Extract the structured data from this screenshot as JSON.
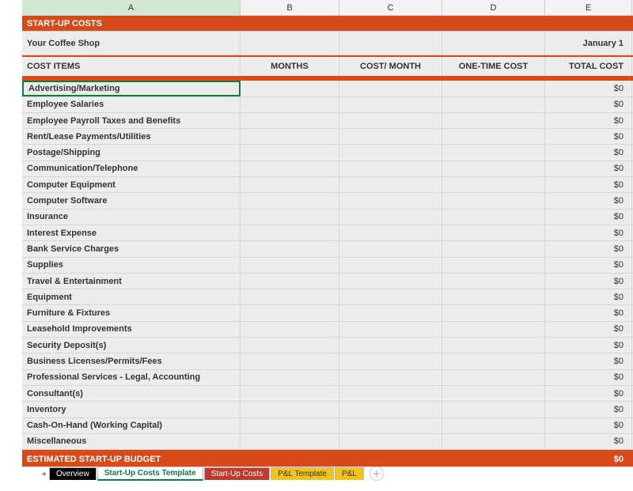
{
  "columns": {
    "a": "A",
    "b": "B",
    "c": "C",
    "d": "D",
    "e": "E"
  },
  "title": "START-UP COSTS",
  "subheader": {
    "label": "Your Coffee Shop",
    "date": "January 1"
  },
  "col_labels": {
    "a": "COST ITEMS",
    "b": "MONTHS",
    "c": "COST/ MONTH",
    "d": "ONE-TIME COST",
    "e": "TOTAL COST"
  },
  "rows": [
    {
      "label": "Advertising/Marketing",
      "total": "$0"
    },
    {
      "label": "Employee Salaries",
      "total": "$0"
    },
    {
      "label": "Employee Payroll Taxes and Benefits",
      "total": "$0"
    },
    {
      "label": "Rent/Lease Payments/Utilities",
      "total": "$0"
    },
    {
      "label": "Postage/Shipping",
      "total": "$0"
    },
    {
      "label": "Communication/Telephone",
      "total": "$0"
    },
    {
      "label": "Computer Equipment",
      "total": "$0"
    },
    {
      "label": "Computer Software",
      "total": "$0"
    },
    {
      "label": "Insurance",
      "total": "$0"
    },
    {
      "label": "Interest Expense",
      "total": "$0"
    },
    {
      "label": "Bank Service Charges",
      "total": "$0"
    },
    {
      "label": "Supplies",
      "total": "$0"
    },
    {
      "label": "Travel & Entertainment",
      "total": "$0"
    },
    {
      "label": "Equipment",
      "total": "$0"
    },
    {
      "label": "Furniture & Fixtures",
      "total": "$0"
    },
    {
      "label": "Leasehold Improvements",
      "total": "$0"
    },
    {
      "label": "Security Deposit(s)",
      "total": "$0"
    },
    {
      "label": "Business Licenses/Permits/Fees",
      "total": "$0"
    },
    {
      "label": "Professional Services - Legal, Accounting",
      "total": "$0"
    },
    {
      "label": "Consultant(s)",
      "total": "$0"
    },
    {
      "label": "Inventory",
      "total": "$0"
    },
    {
      "label": "Cash-On-Hand (Working Capital)",
      "total": "$0"
    },
    {
      "label": "Miscellaneous",
      "total": "$0"
    }
  ],
  "footer": {
    "label": "ESTIMATED START-UP BUDGET",
    "total": "$0"
  },
  "tabs": {
    "overview": "Overview",
    "startup_template": "Start-Up Costs Template",
    "startup_costs": "Start-Up Costs",
    "pl_template": "P&L Template",
    "pl": "P&L"
  }
}
